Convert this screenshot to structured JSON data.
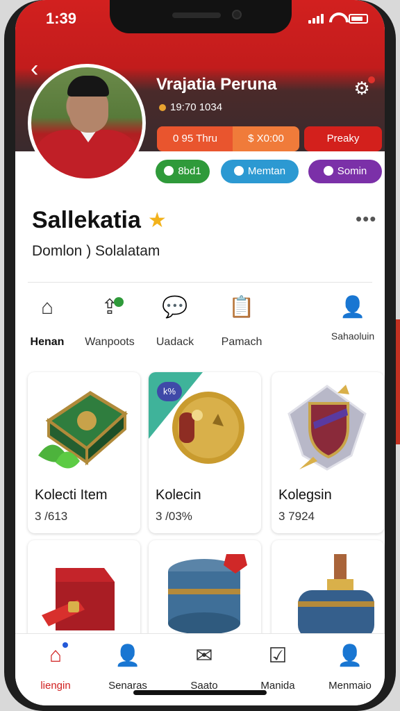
{
  "status_bar": {
    "time": "1:39"
  },
  "header": {
    "profile_name": "Vrajatia Peruna",
    "profile_meta": "19:70 1034",
    "stat_buttons": [
      "0 95 Thru",
      "$ X0:00",
      "Preaky"
    ],
    "pills": [
      "8bd1",
      "Memtan",
      "Somin"
    ]
  },
  "profile": {
    "title": "Sallekatia",
    "subtitle": "Domlon ) Solalatam"
  },
  "tabs": [
    {
      "label": "Henan",
      "icon": "house-icon"
    },
    {
      "label": "Wanpoots",
      "icon": "upload-box-icon"
    },
    {
      "label": "Uadack",
      "icon": "chat-bubble-icon"
    },
    {
      "label": "Pamach",
      "icon": "clipboard-icon"
    },
    {
      "label": "Sahaoluin",
      "icon": "person-icon"
    }
  ],
  "cards": [
    {
      "name": "Kolecti Item",
      "count": "3 /613"
    },
    {
      "name": "Kolecin",
      "count": "3 /03%"
    },
    {
      "name": "Kolegsin",
      "count": "3 7924"
    }
  ],
  "card_badge": "k%",
  "bottom_nav": [
    {
      "label": "liengin",
      "icon": "home-icon"
    },
    {
      "label": "Senaras",
      "icon": "person-icon"
    },
    {
      "label": "Saato",
      "icon": "message-icon"
    },
    {
      "label": "Manida",
      "icon": "box-check-icon"
    },
    {
      "label": "Menmaio",
      "icon": "profile-icon"
    }
  ],
  "colors": {
    "primary": "#d2201f",
    "accent_green": "#2f9a3a",
    "accent_blue": "#2c99d2",
    "accent_purple": "#7b30a8"
  }
}
